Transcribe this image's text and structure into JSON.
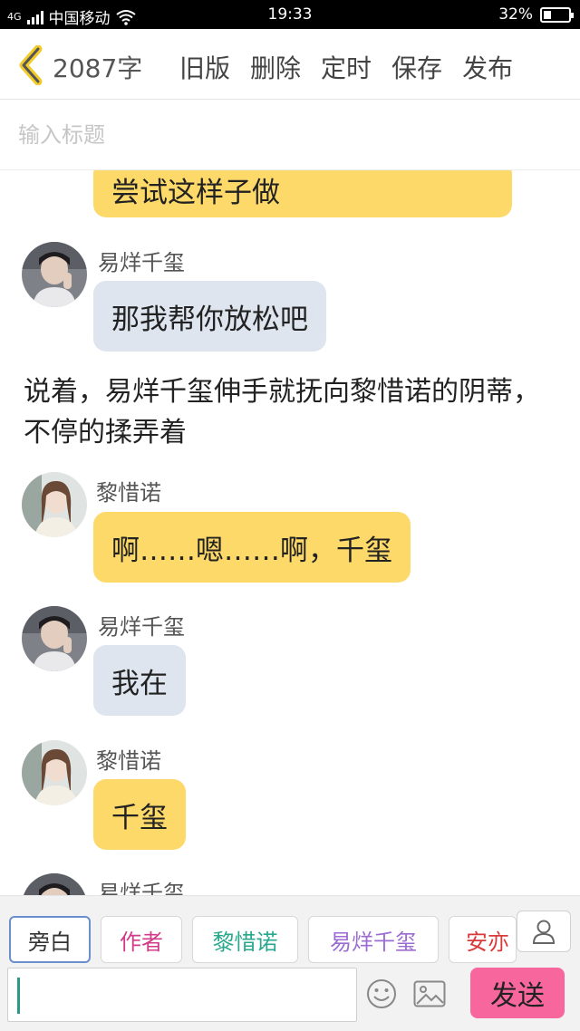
{
  "status_bar": {
    "network": "4G",
    "carrier": "中国移动",
    "time": "19:33",
    "battery_text": "32%",
    "battery_level": 0.32
  },
  "header": {
    "word_count": "2087字",
    "actions": [
      "旧版",
      "删除",
      "定时",
      "保存",
      "发布"
    ],
    "icons": {
      "back": "chevron-left-icon"
    },
    "accent": "#f2cc2c"
  },
  "title_field": {
    "placeholder": "输入标题",
    "value": ""
  },
  "chat": {
    "partial_top_bubble": "尝试这样子做",
    "messages": [
      {
        "speaker": "易烊千玺",
        "text": "那我帮你放松吧",
        "bubble_color": "#dfe5ee"
      },
      {
        "narration": "说着，易烊千玺伸手就抚向黎惜诺的阴蒂，不停的揉弄着"
      },
      {
        "speaker": "黎惜诺",
        "text": "啊……嗯……啊，千玺",
        "bubble_color": "#fdd96a"
      },
      {
        "speaker": "易烊千玺",
        "text": "我在",
        "bubble_color": "#dfe5ee"
      },
      {
        "speaker": "黎惜诺",
        "text": "千玺",
        "bubble_color": "#fdd96a"
      },
      {
        "speaker": "易烊千玺",
        "text": "",
        "partial": true
      }
    ]
  },
  "roles": [
    {
      "label": "旁白",
      "color": "#333333",
      "active": true
    },
    {
      "label": "作者",
      "color": "#d23a8a",
      "active": false
    },
    {
      "label": "黎惜诺",
      "color": "#2aa88e",
      "active": false
    },
    {
      "label": "易烊千玺",
      "color": "#9b6cd2",
      "active": false
    },
    {
      "label": "安亦",
      "color": "#d83a3a",
      "active": false
    }
  ],
  "input_bar": {
    "placeholder": "",
    "send_label": "发送",
    "send_color": "#f7669d",
    "icons": [
      "emoji-icon",
      "image-icon",
      "person-icon"
    ]
  }
}
